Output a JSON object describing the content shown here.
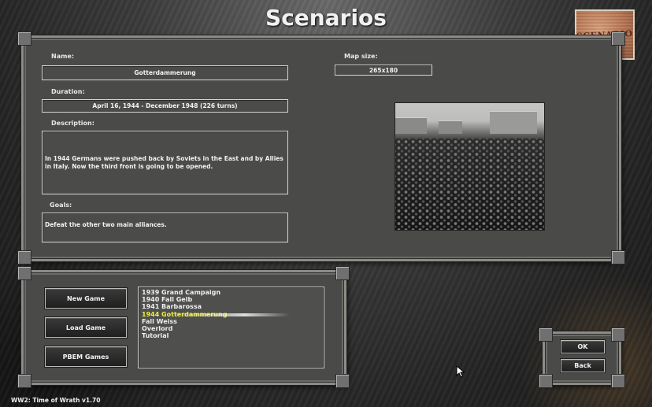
{
  "title": "Scenarios",
  "logo": {
    "text": "SCENARIO"
  },
  "details": {
    "name_label": "Name:",
    "name_value": "Gotterdammerung",
    "map_size_label": "Map size:",
    "map_size_value": "265x180",
    "duration_label": "Duration:",
    "duration_value": "April 16, 1944 - December 1948 (226 turns)",
    "description_label": "Description:",
    "description_value": "In 1944 Germans were pushed back by Soviets in the East and by Allies in Italy. Now the third front is going to be opened.",
    "goals_label": "Goals:",
    "goals_value": "Defeat the other two main alliances."
  },
  "buttons": {
    "new_game": "New Game",
    "load_game": "Load Game",
    "pbem_games": "PBEM Games",
    "ok": "OK",
    "back": "Back"
  },
  "scenario_list": {
    "items": [
      "1939 Grand Campaign",
      "1940 Fall Gelb",
      "1941 Barbarossa",
      "1944 Gotterdammerung",
      "Fall Weiss",
      "Overlord",
      "Tutorial"
    ],
    "selected_index": 3
  },
  "version": "WW2: Time of Wrath v1.70",
  "colors": {
    "selected_text": "#f1f135",
    "panel_bg": "#4a4a48"
  }
}
